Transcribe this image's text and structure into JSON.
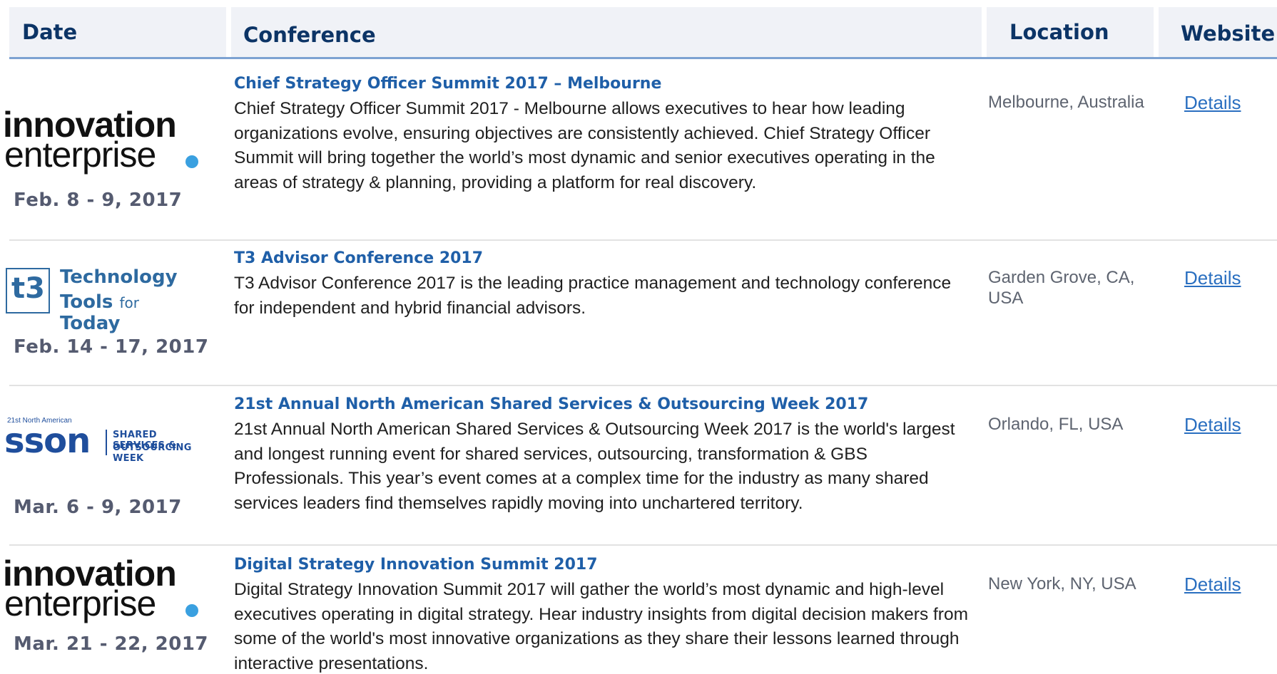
{
  "header": {
    "date": "Date",
    "conference": "Conference",
    "location": "Location",
    "website": "Website"
  },
  "logos": {
    "innovation_enterprise": {
      "line1": "innovation",
      "line2": "enterprise",
      "mark": "ie"
    },
    "t3": {
      "mark": "t3",
      "line1": "Technology",
      "line2_a": "Tools",
      "line2_b": "for",
      "line2_c": "Today"
    },
    "sson": {
      "top": "21st North American",
      "mark": "sson",
      "right1": "SHARED SERVICES &",
      "right2": "OUTSOURCING WEEK"
    }
  },
  "rows": [
    {
      "date": "Feb. 8 - 9, 2017",
      "title": "Chief Strategy Officer Summit 2017 – Melbourne",
      "description": "Chief Strategy Officer Summit 2017 - Melbourne allows executives to hear how leading organizations evolve, ensuring objectives are consistently achieved. Chief Strategy Officer Summit will bring together the world’s most dynamic and senior executives operating in the areas of strategy & planning, providing a platform for real discovery.",
      "location": "Melbourne, Australia",
      "link": "Details"
    },
    {
      "date": "Feb. 14 - 17, 2017",
      "title": "T3 Advisor Conference 2017",
      "description": "T3 Advisor Conference 2017 is the leading practice management and technology conference for independent and hybrid financial advisors.",
      "location": "Garden Grove, CA, USA",
      "link": "Details"
    },
    {
      "date": "Mar. 6 - 9, 2017",
      "title": "21st Annual North American Shared Services & Outsourcing Week 2017",
      "description": "21st Annual North American Shared Services & Outsourcing Week 2017 is the world's largest and longest running event for shared services, outsourcing, transformation & GBS Professionals. This year’s event comes at a complex time for the industry as many shared services leaders find themselves rapidly moving into unchartered territory.",
      "location": "Orlando, FL, USA",
      "link": "Details"
    },
    {
      "date": "Mar. 21 - 22, 2017",
      "title": "Digital Strategy Innovation Summit 2017",
      "description": "Digital Strategy Innovation Summit 2017 will gather the world’s most dynamic and high-level executives operating in digital strategy. Hear industry insights from digital decision makers from some of the world's most innovative organizations as they share their lessons learned through interactive presentations.",
      "location": "New York, NY, USA",
      "link": "Details"
    }
  ]
}
